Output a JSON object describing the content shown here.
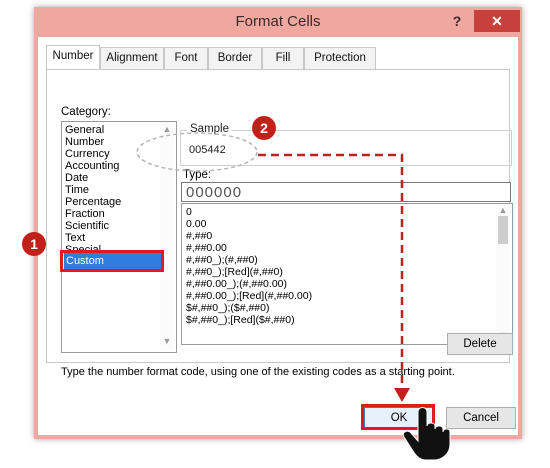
{
  "window": {
    "title": "Format Cells",
    "help": "?",
    "close": "✕"
  },
  "tabs": [
    "Number",
    "Alignment",
    "Font",
    "Border",
    "Fill",
    "Protection"
  ],
  "category": {
    "label": "Category:",
    "items": [
      "General",
      "Number",
      "Currency",
      "Accounting",
      "Date",
      "Time",
      "Percentage",
      "Fraction",
      "Scientific",
      "Text",
      "Special",
      "Custom"
    ],
    "selected": "Custom"
  },
  "sample": {
    "label": "Sample",
    "value": "005442"
  },
  "type": {
    "label": "Type:",
    "value": "000000",
    "formats": [
      "0",
      "0.00",
      "#,##0",
      "#,##0.00",
      "#,##0_);(#,##0)",
      "#,##0_);[Red](#,##0)",
      "#,##0.00_);(#,##0.00)",
      "#,##0.00_);[Red](#,##0.00)",
      "$#,##0_);($#,##0)",
      "$#,##0_);[Red]($#,##0)"
    ]
  },
  "buttons": {
    "delete": "Delete",
    "ok": "OK",
    "cancel": "Cancel"
  },
  "description": "Type the number format code, using one of the existing codes as a starting point.",
  "annotations": {
    "step1": "1",
    "step2": "2"
  },
  "colors": {
    "accent_red": "#e01b1b",
    "selection_blue": "#2f7de1",
    "titlebar": "#f0a7a0",
    "close_red": "#c7403b"
  }
}
